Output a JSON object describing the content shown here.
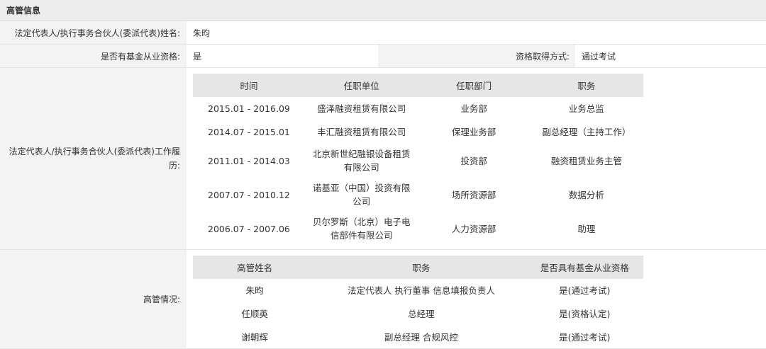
{
  "section": {
    "title": "高管信息"
  },
  "legal_rep": {
    "label": "法定代表人/执行事务合伙人(委派代表)姓名:",
    "value": "朱昀"
  },
  "fund_qual": {
    "label": "是否有基金从业资格:",
    "value": "是",
    "method_label": "资格取得方式:",
    "method_value": "通过考试"
  },
  "resume": {
    "label": "法定代表人/执行事务合伙人(委派代表)工作履历:",
    "columns": [
      "时间",
      "任职单位",
      "任职部门",
      "职务"
    ],
    "rows": [
      {
        "time": "2015.01 - 2016.09",
        "company": "盛泽融资租赁有限公司",
        "dept": "业务部",
        "title": "业务总监"
      },
      {
        "time": "2014.07 - 2015.01",
        "company": "丰汇融资租赁有限公司",
        "dept": "保理业务部",
        "title": "副总经理（主持工作）"
      },
      {
        "time": "2011.01 - 2014.03",
        "company": "北京新世纪融银设备租赁有限公司",
        "dept": "投资部",
        "title": "融资租赁业务主管"
      },
      {
        "time": "2007.07 - 2010.12",
        "company": "诺基亚（中国）投资有限公司",
        "dept": "场所资源部",
        "title": "数据分析"
      },
      {
        "time": "2006.07 - 2007.06",
        "company": "贝尔罗斯（北京）电子电信部件有限公司",
        "dept": "人力资源部",
        "title": "助理"
      }
    ]
  },
  "executives": {
    "label": "高管情况:",
    "columns": [
      "高管姓名",
      "职务",
      "是否具有基金从业资格"
    ],
    "rows": [
      {
        "name": "朱昀",
        "title": "法定代表人 执行董事 信息填报负责人",
        "qual": "是(通过考试)"
      },
      {
        "name": "任顺英",
        "title": "总经理",
        "qual": "是(资格认定)"
      },
      {
        "name": "谢朝辉",
        "title": "副总经理 合规风控",
        "qual": "是(通过考试)"
      }
    ]
  }
}
